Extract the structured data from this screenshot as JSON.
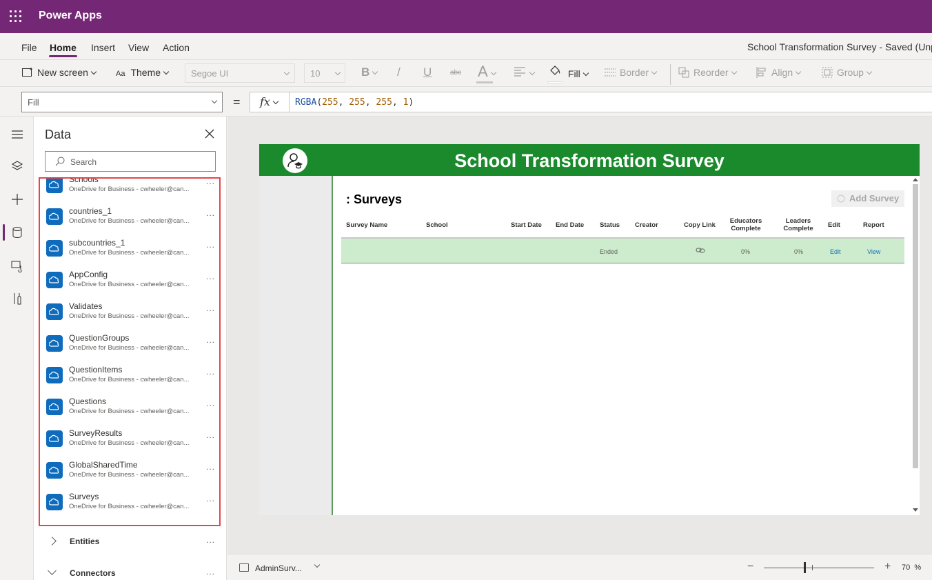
{
  "app": {
    "title": "Power Apps",
    "accent": "#742774"
  },
  "menu": {
    "items": [
      "File",
      "Home",
      "Insert",
      "View",
      "Action"
    ],
    "active": "Home",
    "doc_title": "School Transformation Survey - Saved (Unp"
  },
  "toolbar": {
    "new_screen": "New screen",
    "theme": "Theme",
    "font": "Segoe UI",
    "font_size": "10",
    "bold": "B",
    "italic": "/",
    "underline": "U",
    "strike": "abc",
    "font_color": "A",
    "fill": "Fill",
    "border": "Border",
    "reorder": "Reorder",
    "align": "Align",
    "group": "Group"
  },
  "formula_bar": {
    "property": "Fill",
    "equals": "=",
    "fx": "fx",
    "fn": "RGBA",
    "args": [
      "255",
      "255",
      "255",
      "1"
    ]
  },
  "data_panel": {
    "title": "Data",
    "search_placeholder": "Search",
    "items": [
      {
        "name": "Schools",
        "source": "OneDrive for Business - cwheeler@can..."
      },
      {
        "name": "countries_1",
        "source": "OneDrive for Business - cwheeler@can..."
      },
      {
        "name": "subcountries_1",
        "source": "OneDrive for Business - cwheeler@can..."
      },
      {
        "name": "AppConfig",
        "source": "OneDrive for Business - cwheeler@can..."
      },
      {
        "name": "Validates",
        "source": "OneDrive for Business - cwheeler@can..."
      },
      {
        "name": "QuestionGroups",
        "source": "OneDrive for Business - cwheeler@can..."
      },
      {
        "name": "QuestionItems",
        "source": "OneDrive for Business - cwheeler@can..."
      },
      {
        "name": "Questions",
        "source": "OneDrive for Business - cwheeler@can..."
      },
      {
        "name": "SurveyResults",
        "source": "OneDrive for Business - cwheeler@can..."
      },
      {
        "name": "GlobalSharedTime",
        "source": "OneDrive for Business - cwheeler@can..."
      },
      {
        "name": "Surveys",
        "source": "OneDrive for Business - cwheeler@can..."
      }
    ],
    "more": "...",
    "sections": [
      "Entities",
      "Connectors"
    ]
  },
  "canvas": {
    "header_title": "School Transformation Survey",
    "header_color": "#1b8a2c",
    "section_title": ": Surveys",
    "add_button": "Add Survey",
    "columns": [
      "Survey Name",
      "School",
      "Start Date",
      "End Date",
      "Status",
      "Creator",
      "Copy Link",
      "Educators Complete",
      "Leaders Complete",
      "Edit",
      "Report"
    ],
    "row": {
      "status": "Ended",
      "educators": "0%",
      "leaders": "0%",
      "edit": "Edit",
      "report": "View"
    }
  },
  "status_bar": {
    "screen": "AdminSurv...",
    "zoom_minus": "−",
    "zoom_plus": "+",
    "zoom": "70",
    "zoom_unit": "%",
    "zoom_level": 0.7
  }
}
